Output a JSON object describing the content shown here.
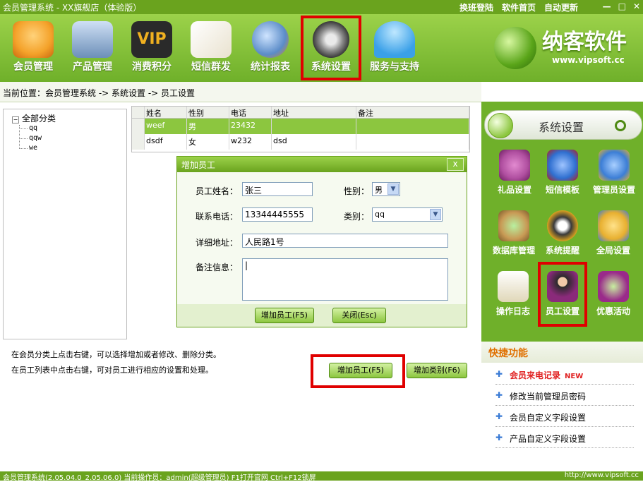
{
  "window": {
    "title": "会员管理系统 - XX旗舰店（体验版）",
    "links": [
      "换班登陆",
      "软件首页",
      "自动更新"
    ],
    "controls": [
      "—",
      "□",
      "✕"
    ]
  },
  "toolbar": {
    "items": [
      {
        "label": "会员管理",
        "icon": "members-icon",
        "color": "#f4a22a"
      },
      {
        "label": "产品管理",
        "icon": "monitor-icon",
        "color": "#6c8fb8"
      },
      {
        "label": "消费积分",
        "icon": "vip-icon",
        "color": "#2a2a2a"
      },
      {
        "label": "短信群发",
        "icon": "letter-icon",
        "color": "#e9e2cf"
      },
      {
        "label": "统计报表",
        "icon": "clock-globe-icon",
        "color": "#5b8cc8"
      },
      {
        "label": "系统设置",
        "icon": "gear-icon",
        "color": "#8a8a8a"
      },
      {
        "label": "服务与支持",
        "icon": "umbrella-icon",
        "color": "#3aa0e8"
      }
    ]
  },
  "logo": {
    "name": "纳客软件",
    "url": "www.vipsoft.cc"
  },
  "breadcrumb": "当前位置：会员管理系统 -> 系统设置 -> 员工设置",
  "tree": {
    "root": "全部分类",
    "children": [
      "qq",
      "qqw",
      "we"
    ]
  },
  "grid": {
    "columns": [
      "姓名",
      "性别",
      "电话",
      "地址",
      "备注"
    ],
    "rows": [
      [
        "weef",
        "男",
        "23432",
        "",
        ""
      ],
      [
        "dsdf",
        "女",
        "w232",
        "dsd",
        ""
      ]
    ]
  },
  "dialog": {
    "title": "增加员工",
    "close": "x",
    "labels": {
      "name": "员工姓名：",
      "gender": "性别：",
      "phone": "联系电话：",
      "category": "类别：",
      "address": "详细地址：",
      "notes": "备注信息："
    },
    "values": {
      "name": "张三",
      "gender": "男",
      "phone": "13344445555",
      "category": "qq",
      "address": "人民路1号",
      "notes": "|"
    },
    "buttons": {
      "add": "增加员工(F5)",
      "close": "关闭(Esc)"
    }
  },
  "hints": [
    "在会员分类上点击右键，可以选择增加或者修改、删除分类。",
    "在员工列表中点击右键，可对员工进行相应的设置和处理。"
  ],
  "main_buttons": {
    "add_employee": "增加员工(F5)",
    "add_category": "增加类别(F6)"
  },
  "right_panel": {
    "title": "系统设置",
    "items": [
      {
        "label": "礼品设置",
        "icon": "gift-icon",
        "color": "#b04fa0"
      },
      {
        "label": "短信模板",
        "icon": "sms-template-icon",
        "color": "#2f6fd0"
      },
      {
        "label": "管理员设置",
        "icon": "admin-lock-icon",
        "color": "#3c7ed6"
      },
      {
        "label": "数据库管理",
        "icon": "database-icon",
        "color": "#c89a55"
      },
      {
        "label": "系统提醒",
        "icon": "compass-icon",
        "color": "#d8a020"
      },
      {
        "label": "全局设置",
        "icon": "global-settings-icon",
        "color": "#e8b030"
      },
      {
        "label": "操作日志",
        "icon": "log-icon",
        "color": "#e0d7b8"
      },
      {
        "label": "员工设置",
        "icon": "employee-icon",
        "color": "#8a2a7a"
      },
      {
        "label": "优惠活动",
        "icon": "promotion-icon",
        "color": "#9a2a8a"
      }
    ]
  },
  "quick": {
    "title": "快捷功能",
    "items": [
      {
        "label": "会员来电记录",
        "badge": "NEW"
      },
      {
        "label": "修改当前管理员密码",
        "badge": ""
      },
      {
        "label": "会员自定义字段设置",
        "badge": ""
      },
      {
        "label": "产品自定义字段设置",
        "badge": ""
      }
    ]
  },
  "status": {
    "left": "会员管理系统(2.05.04.0_2.05.06.0) 当前操作员：admin(超级管理员) F1打开官网 Ctrl+F12锁屏",
    "right": "http://www.vipsoft.cc"
  }
}
